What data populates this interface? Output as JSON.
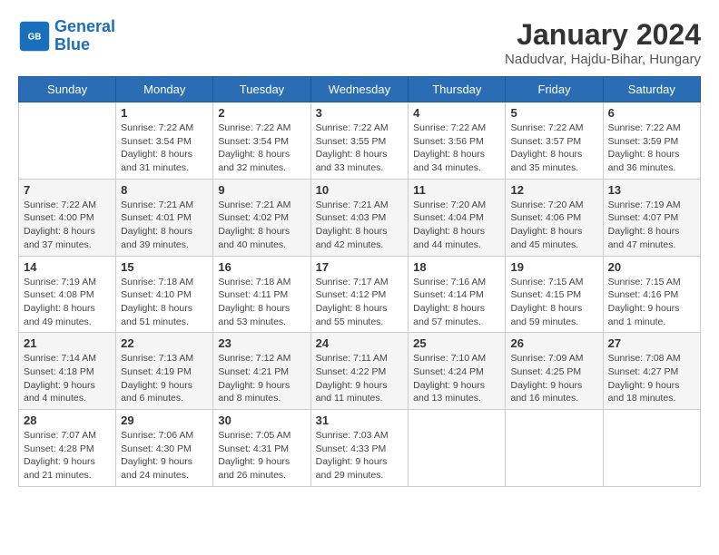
{
  "header": {
    "logo_line1": "General",
    "logo_line2": "Blue",
    "month": "January 2024",
    "location": "Nadudvar, Hajdu-Bihar, Hungary"
  },
  "days_of_week": [
    "Sunday",
    "Monday",
    "Tuesday",
    "Wednesday",
    "Thursday",
    "Friday",
    "Saturday"
  ],
  "weeks": [
    [
      {
        "num": "",
        "info": ""
      },
      {
        "num": "1",
        "info": "Sunrise: 7:22 AM\nSunset: 3:54 PM\nDaylight: 8 hours\nand 31 minutes."
      },
      {
        "num": "2",
        "info": "Sunrise: 7:22 AM\nSunset: 3:54 PM\nDaylight: 8 hours\nand 32 minutes."
      },
      {
        "num": "3",
        "info": "Sunrise: 7:22 AM\nSunset: 3:55 PM\nDaylight: 8 hours\nand 33 minutes."
      },
      {
        "num": "4",
        "info": "Sunrise: 7:22 AM\nSunset: 3:56 PM\nDaylight: 8 hours\nand 34 minutes."
      },
      {
        "num": "5",
        "info": "Sunrise: 7:22 AM\nSunset: 3:57 PM\nDaylight: 8 hours\nand 35 minutes."
      },
      {
        "num": "6",
        "info": "Sunrise: 7:22 AM\nSunset: 3:59 PM\nDaylight: 8 hours\nand 36 minutes."
      }
    ],
    [
      {
        "num": "7",
        "info": "Sunrise: 7:22 AM\nSunset: 4:00 PM\nDaylight: 8 hours\nand 37 minutes."
      },
      {
        "num": "8",
        "info": "Sunrise: 7:21 AM\nSunset: 4:01 PM\nDaylight: 8 hours\nand 39 minutes."
      },
      {
        "num": "9",
        "info": "Sunrise: 7:21 AM\nSunset: 4:02 PM\nDaylight: 8 hours\nand 40 minutes."
      },
      {
        "num": "10",
        "info": "Sunrise: 7:21 AM\nSunset: 4:03 PM\nDaylight: 8 hours\nand 42 minutes."
      },
      {
        "num": "11",
        "info": "Sunrise: 7:20 AM\nSunset: 4:04 PM\nDaylight: 8 hours\nand 44 minutes."
      },
      {
        "num": "12",
        "info": "Sunrise: 7:20 AM\nSunset: 4:06 PM\nDaylight: 8 hours\nand 45 minutes."
      },
      {
        "num": "13",
        "info": "Sunrise: 7:19 AM\nSunset: 4:07 PM\nDaylight: 8 hours\nand 47 minutes."
      }
    ],
    [
      {
        "num": "14",
        "info": "Sunrise: 7:19 AM\nSunset: 4:08 PM\nDaylight: 8 hours\nand 49 minutes."
      },
      {
        "num": "15",
        "info": "Sunrise: 7:18 AM\nSunset: 4:10 PM\nDaylight: 8 hours\nand 51 minutes."
      },
      {
        "num": "16",
        "info": "Sunrise: 7:18 AM\nSunset: 4:11 PM\nDaylight: 8 hours\nand 53 minutes."
      },
      {
        "num": "17",
        "info": "Sunrise: 7:17 AM\nSunset: 4:12 PM\nDaylight: 8 hours\nand 55 minutes."
      },
      {
        "num": "18",
        "info": "Sunrise: 7:16 AM\nSunset: 4:14 PM\nDaylight: 8 hours\nand 57 minutes."
      },
      {
        "num": "19",
        "info": "Sunrise: 7:15 AM\nSunset: 4:15 PM\nDaylight: 8 hours\nand 59 minutes."
      },
      {
        "num": "20",
        "info": "Sunrise: 7:15 AM\nSunset: 4:16 PM\nDaylight: 9 hours\nand 1 minute."
      }
    ],
    [
      {
        "num": "21",
        "info": "Sunrise: 7:14 AM\nSunset: 4:18 PM\nDaylight: 9 hours\nand 4 minutes."
      },
      {
        "num": "22",
        "info": "Sunrise: 7:13 AM\nSunset: 4:19 PM\nDaylight: 9 hours\nand 6 minutes."
      },
      {
        "num": "23",
        "info": "Sunrise: 7:12 AM\nSunset: 4:21 PM\nDaylight: 9 hours\nand 8 minutes."
      },
      {
        "num": "24",
        "info": "Sunrise: 7:11 AM\nSunset: 4:22 PM\nDaylight: 9 hours\nand 11 minutes."
      },
      {
        "num": "25",
        "info": "Sunrise: 7:10 AM\nSunset: 4:24 PM\nDaylight: 9 hours\nand 13 minutes."
      },
      {
        "num": "26",
        "info": "Sunrise: 7:09 AM\nSunset: 4:25 PM\nDaylight: 9 hours\nand 16 minutes."
      },
      {
        "num": "27",
        "info": "Sunrise: 7:08 AM\nSunset: 4:27 PM\nDaylight: 9 hours\nand 18 minutes."
      }
    ],
    [
      {
        "num": "28",
        "info": "Sunrise: 7:07 AM\nSunset: 4:28 PM\nDaylight: 9 hours\nand 21 minutes."
      },
      {
        "num": "29",
        "info": "Sunrise: 7:06 AM\nSunset: 4:30 PM\nDaylight: 9 hours\nand 24 minutes."
      },
      {
        "num": "30",
        "info": "Sunrise: 7:05 AM\nSunset: 4:31 PM\nDaylight: 9 hours\nand 26 minutes."
      },
      {
        "num": "31",
        "info": "Sunrise: 7:03 AM\nSunset: 4:33 PM\nDaylight: 9 hours\nand 29 minutes."
      },
      {
        "num": "",
        "info": ""
      },
      {
        "num": "",
        "info": ""
      },
      {
        "num": "",
        "info": ""
      }
    ]
  ]
}
